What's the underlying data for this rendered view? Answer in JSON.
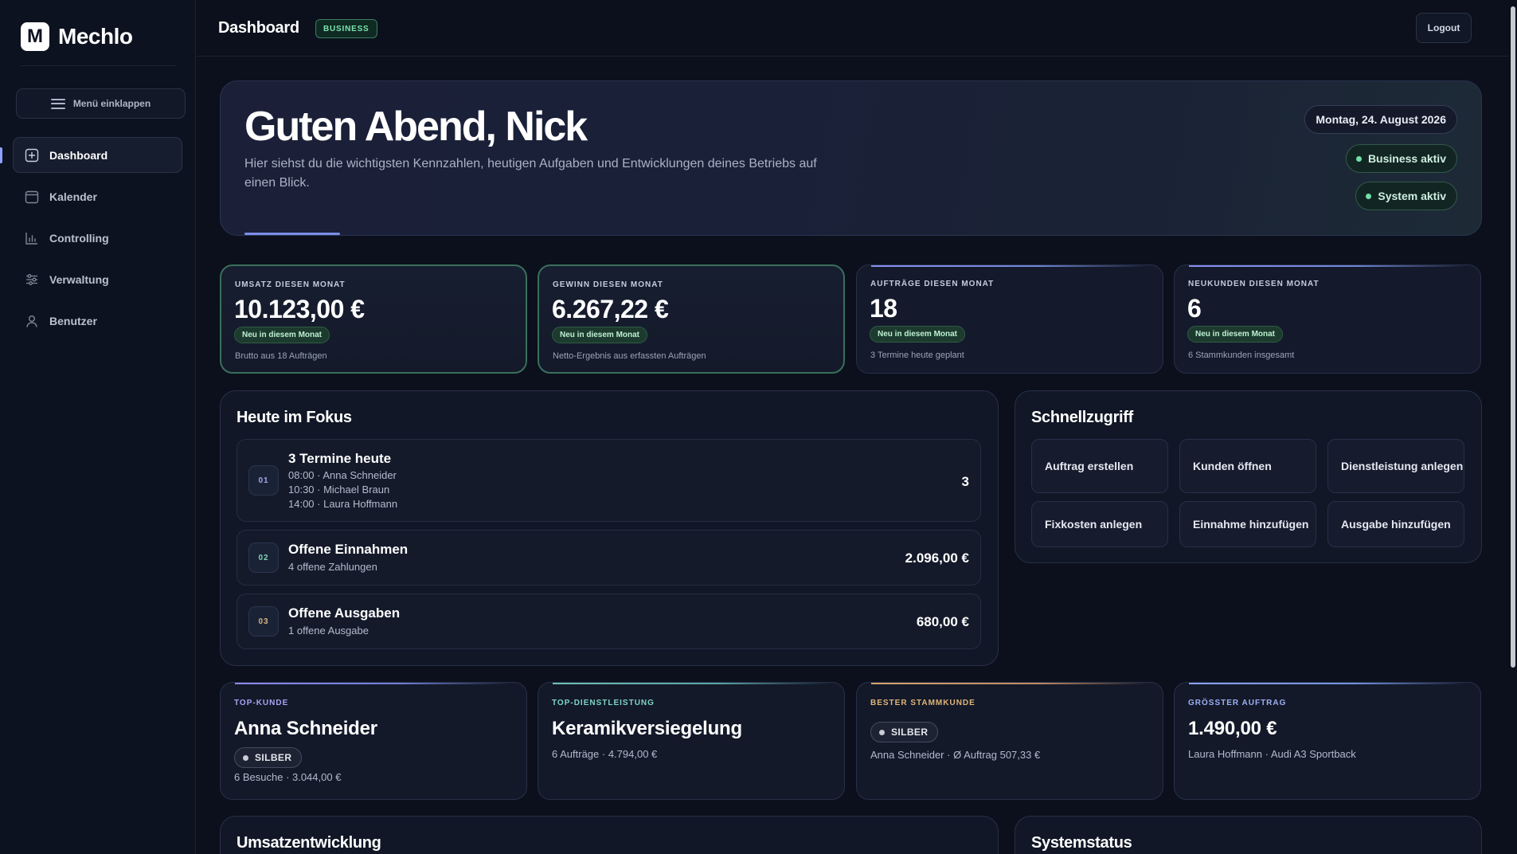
{
  "app": {
    "logo_letter": "M",
    "name": "Mechlo"
  },
  "sidebar": {
    "collapse_label": "Menü einklappen",
    "items": [
      {
        "label": "Dashboard",
        "icon": "dashboard-icon",
        "active": true
      },
      {
        "label": "Kalender",
        "icon": "calendar-icon"
      },
      {
        "label": "Controlling",
        "icon": "chart-icon"
      },
      {
        "label": "Verwaltung",
        "icon": "sliders-icon"
      },
      {
        "label": "Benutzer",
        "icon": "user-icon"
      }
    ]
  },
  "topbar": {
    "title": "Dashboard",
    "plan": "BUSINESS",
    "logout": "Logout"
  },
  "hero": {
    "greeting": "Guten Abend, Nick",
    "subtitle": "Hier siehst du die wichtigsten Kennzahlen, heutigen Aufgaben und Entwicklungen deines Betriebs auf einen Blick.",
    "date": "Montag, 24. August 2026",
    "status": [
      "Business aktiv",
      "System aktiv"
    ]
  },
  "kpis": [
    {
      "label": "UMSATZ DIESEN MONAT",
      "value": "10.123,00 €",
      "badge": "Neu in diesem Monat",
      "note": "Brutto aus 18 Aufträgen"
    },
    {
      "label": "GEWINN DIESEN MONAT",
      "value": "6.267,22 €",
      "badge": "Neu in diesem Monat",
      "note": "Netto-Ergebnis aus erfassten Aufträgen"
    },
    {
      "label": "AUFTRÄGE DIESEN MONAT",
      "value": "18",
      "badge": "Neu in diesem Monat",
      "note": "3 Termine heute geplant"
    },
    {
      "label": "NEUKUNDEN DIESEN MONAT",
      "value": "6",
      "badge": "Neu in diesem Monat",
      "note": "6 Stammkunden insgesamt"
    }
  ],
  "focus": {
    "title": "Heute im Fokus",
    "items": [
      {
        "num": "01",
        "title": "3 Termine heute",
        "lines": [
          "08:00 · Anna Schneider",
          "10:30 · Michael Braun",
          "14:00 · Laura Hoffmann"
        ],
        "value": "3"
      },
      {
        "num": "02",
        "title": "Offene Einnahmen",
        "lines": [
          "4 offene Zahlungen"
        ],
        "value": "2.096,00 €"
      },
      {
        "num": "03",
        "title": "Offene Ausgaben",
        "lines": [
          "1 offene Ausgabe"
        ],
        "value": "680,00 €"
      }
    ]
  },
  "quick": {
    "title": "Schnellzugriff",
    "actions": [
      "Auftrag erstellen",
      "Kunden öffnen",
      "Dienstleistung anlegen",
      "Fixkosten anlegen",
      "Einnahme hinzufügen",
      "Ausgabe hinzufügen"
    ]
  },
  "highlights": [
    {
      "label": "TOP-KUNDE",
      "value": "Anna Schneider",
      "tier": "SILBER",
      "note": "6 Besuche · 3.044,00 €"
    },
    {
      "label": "TOP-DIENSTLEISTUNG",
      "value": "Keramikversiegelung",
      "note": "6 Aufträge · 4.794,00 €"
    },
    {
      "label": "BESTER STAMMKUNDE",
      "tier": "SILBER",
      "note": "Anna Schneider · Ø Auftrag 507,33 €"
    },
    {
      "label": "GRÖSSTER AUFTRAG",
      "value": "1.490,00 €",
      "note": "Laura Hoffmann · Audi A3 Sportback"
    }
  ],
  "lower": {
    "left_title": "Umsatzentwicklung",
    "right_title": "Systemstatus"
  },
  "colors": {
    "background": "#0b101c",
    "accent_green": "#6fe0a7",
    "label_violet": "#a9a3f2",
    "label_teal": "#7fd3c3",
    "label_gold": "#e0b478",
    "label_blue": "#9db0f4"
  }
}
